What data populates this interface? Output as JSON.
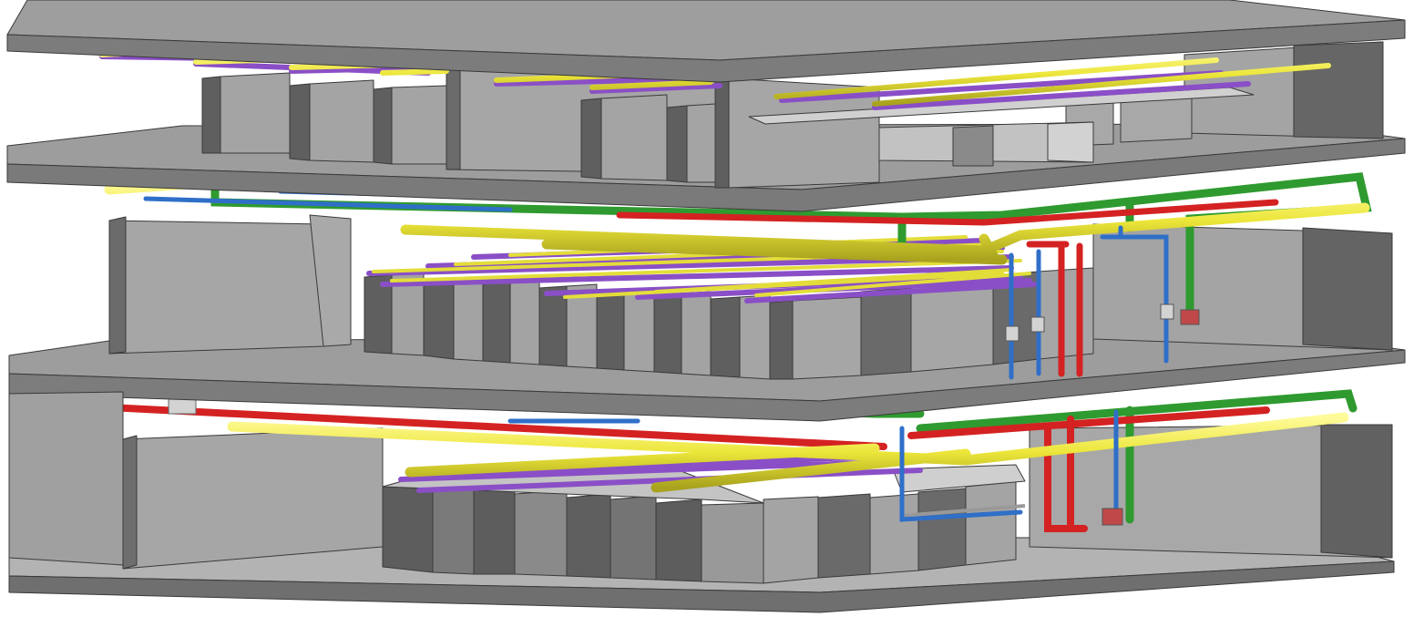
{
  "colors": {
    "slab_top": "#9c9c9c",
    "slab_front": "#7e7e7e",
    "slab_edge": "#555555",
    "wall_face": "#a3a3a3",
    "wall_side": "#6d6d6d",
    "floor": "#b2b2b2",
    "rack_front": "#a4a4a4",
    "rack_side": "#666666",
    "rack_top": "#bcbcbc",
    "pipe_green": "#2f9a2f",
    "pipe_yellow": "#ece63a",
    "pipe_red": "#d42222",
    "pipe_blue": "#2f6fc8",
    "pipe_purple": "#8a4fc6",
    "tray": "#c6c6c6",
    "duct": "#c2c2c2",
    "box": "#c14848"
  },
  "icons": {
    "slab": "floor-slab-icon",
    "rack": "equipment-rack-icon",
    "pipe": "pipe-run-icon"
  }
}
